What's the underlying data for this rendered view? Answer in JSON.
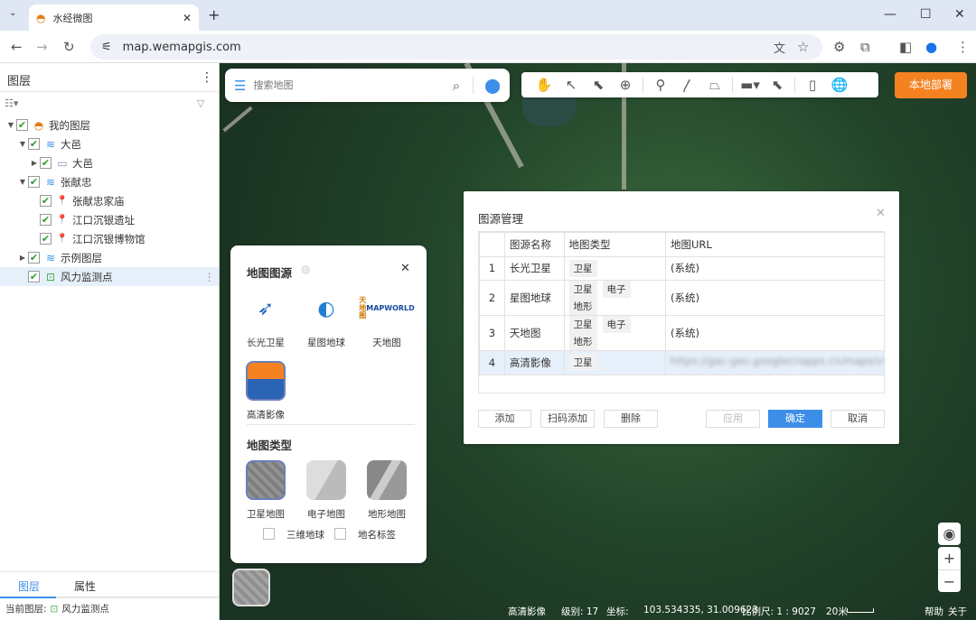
{
  "browser": {
    "tab_title": "水经微图",
    "url": "map.wemapgis.com"
  },
  "sidebar": {
    "title": "图层",
    "tree": [
      {
        "level": 0,
        "exp": "▼",
        "icon": "app-logo-icon",
        "glyph": "◓",
        "label": "我的图层"
      },
      {
        "level": 1,
        "exp": "▼",
        "icon": "layer-icon",
        "glyph": "≋",
        "label": "大邑"
      },
      {
        "level": 2,
        "exp": "▶",
        "icon": "folder-icon",
        "glyph": "▭",
        "label": "大邑"
      },
      {
        "level": 1,
        "exp": "▼",
        "icon": "layer-icon",
        "glyph": "≋",
        "label": "张献忠"
      },
      {
        "level": 2,
        "exp": "",
        "icon": "pin-icon",
        "glyph": "📍",
        "label": "张献忠家庙"
      },
      {
        "level": 2,
        "exp": "",
        "icon": "pin-icon",
        "glyph": "📍",
        "label": "江口沉银遗址"
      },
      {
        "level": 2,
        "exp": "",
        "icon": "pin-icon",
        "glyph": "📍",
        "label": "江口沉银博物馆"
      },
      {
        "level": 1,
        "exp": "▶",
        "icon": "layer-icon",
        "glyph": "≋",
        "label": "示例图层"
      },
      {
        "level": 1,
        "exp": "",
        "icon": "point-layer-icon",
        "glyph": "⊡",
        "label": "风力监测点"
      }
    ],
    "tabs": [
      "图层",
      "属性"
    ],
    "current_layer_label": "当前图层:",
    "current_layer": "风力监测点"
  },
  "search": {
    "placeholder": "搜索地图"
  },
  "deploy_button": "本地部署",
  "source_panel": {
    "title": "地图图源",
    "sources": [
      "长光卫星",
      "星图地球",
      "天地图",
      "高清影像"
    ],
    "tianditu_logo": "天地图 MAPWORLD",
    "type_title": "地图类型",
    "types": [
      "卫星地图",
      "电子地图",
      "地形地图"
    ],
    "checkboxes": [
      "三维地球",
      "地名标签"
    ]
  },
  "dialog": {
    "title": "图源管理",
    "headers": [
      "",
      "图源名称",
      "地图类型",
      "地图URL"
    ],
    "rows": [
      {
        "no": "1",
        "name": "长光卫星",
        "types": [
          "卫星"
        ],
        "url": "(系统)"
      },
      {
        "no": "2",
        "name": "星图地球",
        "types": [
          "卫星",
          "电子",
          "地形"
        ],
        "url": "(系统)"
      },
      {
        "no": "3",
        "name": "天地图",
        "types": [
          "卫星",
          "电子",
          "地形"
        ],
        "url": "(系统)"
      },
      {
        "no": "4",
        "name": "高清影像",
        "types": [
          "卫星"
        ],
        "url": "https://gac-geo.googlecnapps.cn/maps/vt"
      }
    ],
    "buttons": {
      "add": "添加",
      "scan_add": "扫码添加",
      "delete": "删除",
      "apply": "应用",
      "ok": "确定",
      "cancel": "取消"
    },
    "accent": "#3d8ee8"
  },
  "status": {
    "source": "高清影像",
    "level": "级别: 17",
    "coord_label": "坐标:",
    "coord": "103.534335, 31.009623",
    "scale": "比例尺: 1 : 9027",
    "scalebar": "20米",
    "help": "帮助",
    "about": "关于"
  }
}
